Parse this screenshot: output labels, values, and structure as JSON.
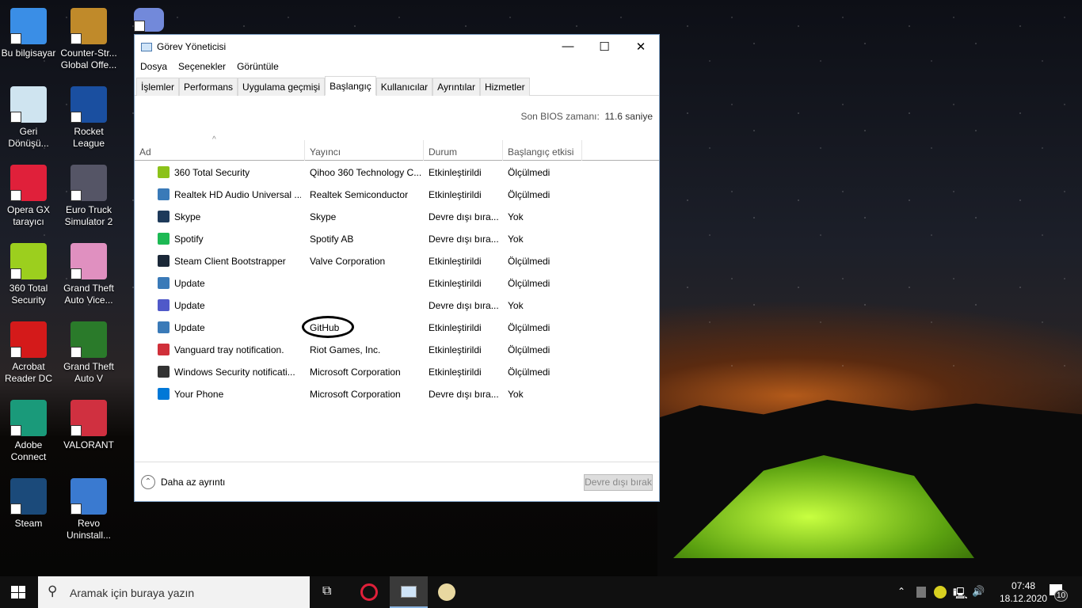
{
  "desktop": {
    "icons": [
      {
        "label": "Bu bilgisayar",
        "color": "#3a8ee6"
      },
      {
        "label": "Counter-Str... Global Offe...",
        "color": "#c08a2a"
      },
      {
        "label": "Geri Dönüşü...",
        "color": "#cfe4f0"
      },
      {
        "label": "Rocket League",
        "color": "#1a4fa0"
      },
      {
        "label": "Opera GX tarayıcı",
        "color": "#e0203a"
      },
      {
        "label": "Euro Truck Simulator 2",
        "color": "#556"
      },
      {
        "label": "360 Total Security",
        "color": "#9ccf1e"
      },
      {
        "label": "Grand Theft Auto Vice...",
        "color": "#e090c0"
      },
      {
        "label": "Acrobat Reader DC",
        "color": "#d41a1a"
      },
      {
        "label": "Grand Theft Auto V",
        "color": "#2a7a2a"
      },
      {
        "label": "Adobe Connect",
        "color": "#1a9a7a"
      },
      {
        "label": "VALORANT",
        "color": "#d03040"
      },
      {
        "label": "Steam",
        "color": "#1b4a7a"
      },
      {
        "label": "Revo Uninstall...",
        "color": "#3a7ad0"
      }
    ]
  },
  "window": {
    "title": "Görev Yöneticisi",
    "menu": [
      "Dosya",
      "Seçenekler",
      "Görüntüle"
    ],
    "tabs": [
      "İşlemler",
      "Performans",
      "Uygulama geçmişi",
      "Başlangıç",
      "Kullanıcılar",
      "Ayrıntılar",
      "Hizmetler"
    ],
    "bios_label": "Son BIOS zamanı:",
    "bios_value": "11.6 saniye",
    "columns": [
      "Ad",
      "Yayıncı",
      "Durum",
      "Başlangıç etkisi"
    ],
    "rows": [
      {
        "name": "360 Total Security",
        "publisher": "Qihoo 360 Technology C...",
        "status": "Etkinleştirildi",
        "impact": "Ölçülmedi",
        "icon_color": "#8cc21a"
      },
      {
        "name": "Realtek HD Audio Universal ...",
        "publisher": "Realtek Semiconductor",
        "status": "Etkinleştirildi",
        "impact": "Ölçülmedi",
        "icon_color": "#3a7ab8"
      },
      {
        "name": "Skype",
        "publisher": "Skype",
        "status": "Devre dışı bıra...",
        "impact": "Yok",
        "icon_color": "#1e3a5a"
      },
      {
        "name": "Spotify",
        "publisher": "Spotify AB",
        "status": "Devre dışı bıra...",
        "impact": "Yok",
        "icon_color": "#1db954"
      },
      {
        "name": "Steam Client Bootstrapper",
        "publisher": "Valve Corporation",
        "status": "Etkinleştirildi",
        "impact": "Ölçülmedi",
        "icon_color": "#1b2838"
      },
      {
        "name": "Update",
        "publisher": "",
        "status": "Etkinleştirildi",
        "impact": "Ölçülmedi",
        "icon_color": "#3a7ab8"
      },
      {
        "name": "Update",
        "publisher": "",
        "status": "Devre dışı bıra...",
        "impact": "Yok",
        "icon_color": "#5059c9"
      },
      {
        "name": "Update",
        "publisher": "GitHub",
        "status": "Etkinleştirildi",
        "impact": "Ölçülmedi",
        "icon_color": "#3a7ab8"
      },
      {
        "name": "Vanguard tray notification.",
        "publisher": "Riot Games, Inc.",
        "status": "Etkinleştirildi",
        "impact": "Ölçülmedi",
        "icon_color": "#d0303a"
      },
      {
        "name": "Windows Security notificati...",
        "publisher": "Microsoft Corporation",
        "status": "Etkinleştirildi",
        "impact": "Ölçülmedi",
        "icon_color": "#333"
      },
      {
        "name": "Your Phone",
        "publisher": "Microsoft Corporation",
        "status": "Devre dışı bıra...",
        "impact": "Yok",
        "icon_color": "#0078d7"
      }
    ],
    "fewer_details": "Daha az ayrıntı",
    "disable_button": "Devre dışı bırak"
  },
  "taskbar": {
    "search_placeholder": "Aramak için buraya yazın",
    "time": "07:48",
    "date": "18.12.2020",
    "notifications": "10"
  }
}
